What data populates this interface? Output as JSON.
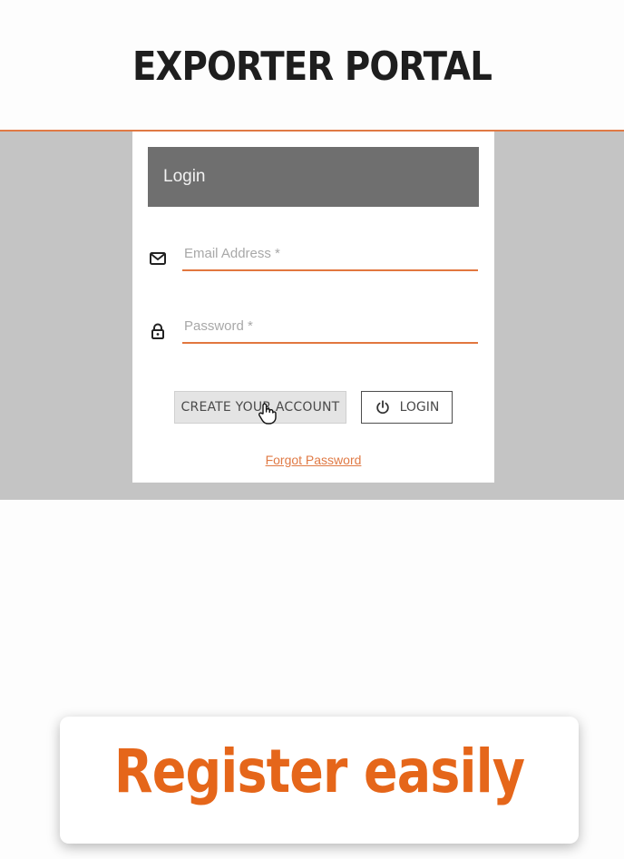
{
  "header": {
    "title": "EXPORTER PORTAL"
  },
  "login_card": {
    "header_label": "Login",
    "email": {
      "placeholder": "Email Address *",
      "value": "",
      "icon": "envelope-icon"
    },
    "password": {
      "placeholder": "Password *",
      "value": "",
      "icon": "lock-icon"
    },
    "create_account_label": "CREATE YOUR ACCOUNT",
    "login_label": "LOGIN",
    "login_icon": "power-icon",
    "forgot_password_label": "Forgot Password"
  },
  "banner": {
    "text": "Register easily"
  },
  "colors": {
    "accent": "#e07a45",
    "banner_text": "#e5661a",
    "card_header": "#6f6f6f",
    "band": "#c4c4c4"
  }
}
